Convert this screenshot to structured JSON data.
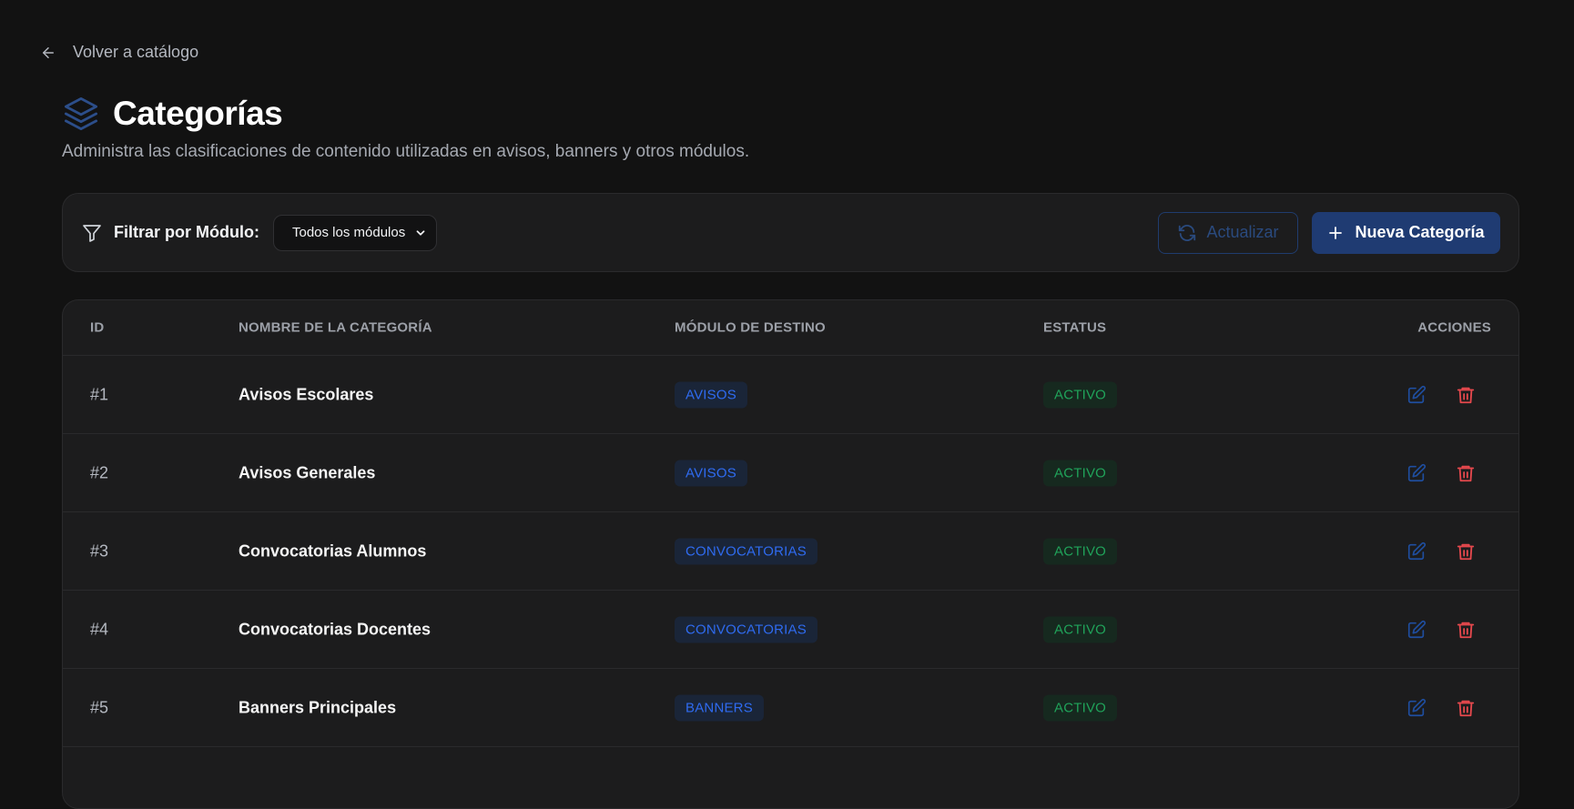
{
  "nav": {
    "back_label": "Volver a catálogo"
  },
  "header": {
    "title": "Categorías",
    "subtitle": "Administra las clasificaciones de contenido utilizadas en avisos, banners y otros módulos."
  },
  "filter": {
    "label": "Filtrar por Módulo:",
    "select_value": "Todos los módulos",
    "refresh_label": "Actualizar",
    "new_label": "Nueva Categoría"
  },
  "table": {
    "headers": {
      "id": "ID",
      "name": "NOMBRE DE LA CATEGORÍA",
      "module": "MÓDULO DE DESTINO",
      "status": "ESTATUS",
      "actions": "ACCIONES"
    },
    "rows": [
      {
        "id": "#1",
        "name": "Avisos Escolares",
        "module": "AVISOS",
        "status": "ACTIVO"
      },
      {
        "id": "#2",
        "name": "Avisos Generales",
        "module": "AVISOS",
        "status": "ACTIVO"
      },
      {
        "id": "#3",
        "name": "Convocatorias Alumnos",
        "module": "CONVOCATORIAS",
        "status": "ACTIVO"
      },
      {
        "id": "#4",
        "name": "Convocatorias Docentes",
        "module": "CONVOCATORIAS",
        "status": "ACTIVO"
      },
      {
        "id": "#5",
        "name": "Banners Principales",
        "module": "BANNERS",
        "status": "ACTIVO"
      }
    ]
  },
  "icons": {
    "back": "arrow-left-icon",
    "title": "layers-icon",
    "filter": "funnel-icon",
    "select": "chevron-down-icon",
    "refresh": "refresh-icon",
    "new": "plus-icon",
    "edit": "edit-icon",
    "delete": "trash-icon"
  },
  "colors": {
    "background": "#121212",
    "card": "#1c1c1d",
    "accent": "#1f3b72",
    "module_badge_text": "#2f6bf0",
    "status_badge_text": "#20a35a",
    "delete": "#e5484d"
  }
}
